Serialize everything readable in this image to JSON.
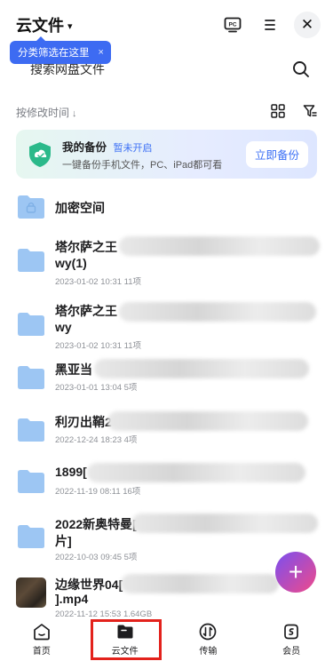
{
  "header": {
    "title": "云文件",
    "caret": "▾",
    "close_glyph": "✕"
  },
  "tooltip": {
    "text": "分类筛选在这里",
    "close": "×"
  },
  "search": {
    "placeholder": "搜索网盘文件"
  },
  "sort": {
    "label": "按修改时间",
    "arrow": "↓"
  },
  "backup": {
    "title": "我的备份",
    "status": "暂未开启",
    "description": "一键备份手机文件，PC、iPad都可看",
    "button": "立即备份"
  },
  "files": [
    {
      "name": "加密空间",
      "meta": "",
      "type": "locked-folder"
    },
    {
      "name": "塔尔萨之王",
      "name2": "wy(1)",
      "meta": "2023-01-02 10:31  11项",
      "type": "folder"
    },
    {
      "name": "塔尔萨之王",
      "name2": "wy",
      "meta": "2023-01-02 10:31  11项",
      "type": "folder"
    },
    {
      "name": "黑亚当",
      "meta": "2023-01-01 13:04  5项",
      "type": "folder"
    },
    {
      "name": "利刃出鞘2",
      "meta": "2022-12-24 18:23  4项",
      "type": "folder"
    },
    {
      "name": "1899[",
      "meta": "2022-11-19 08:11  16项",
      "type": "folder"
    },
    {
      "name": "2022新奥特曼[",
      "name2": "片]",
      "meta": "2022-10-03 09:45  5项",
      "type": "folder"
    },
    {
      "name": "边缘世界04[",
      "name2": "].mp4",
      "meta": "2022-11-12 15:53  1.64GB",
      "type": "video"
    }
  ],
  "fab": {
    "glyph": "+"
  },
  "tabs": [
    {
      "label": "首页",
      "icon": "home-icon"
    },
    {
      "label": "云文件",
      "icon": "folder-icon",
      "active": true
    },
    {
      "label": "传输",
      "icon": "transfer-icon"
    },
    {
      "label": "会员",
      "icon": "vip-icon"
    }
  ],
  "colors": {
    "accent": "#3b6ff5",
    "folder": "#9dc6f3",
    "highlight_box": "#e3221c"
  }
}
